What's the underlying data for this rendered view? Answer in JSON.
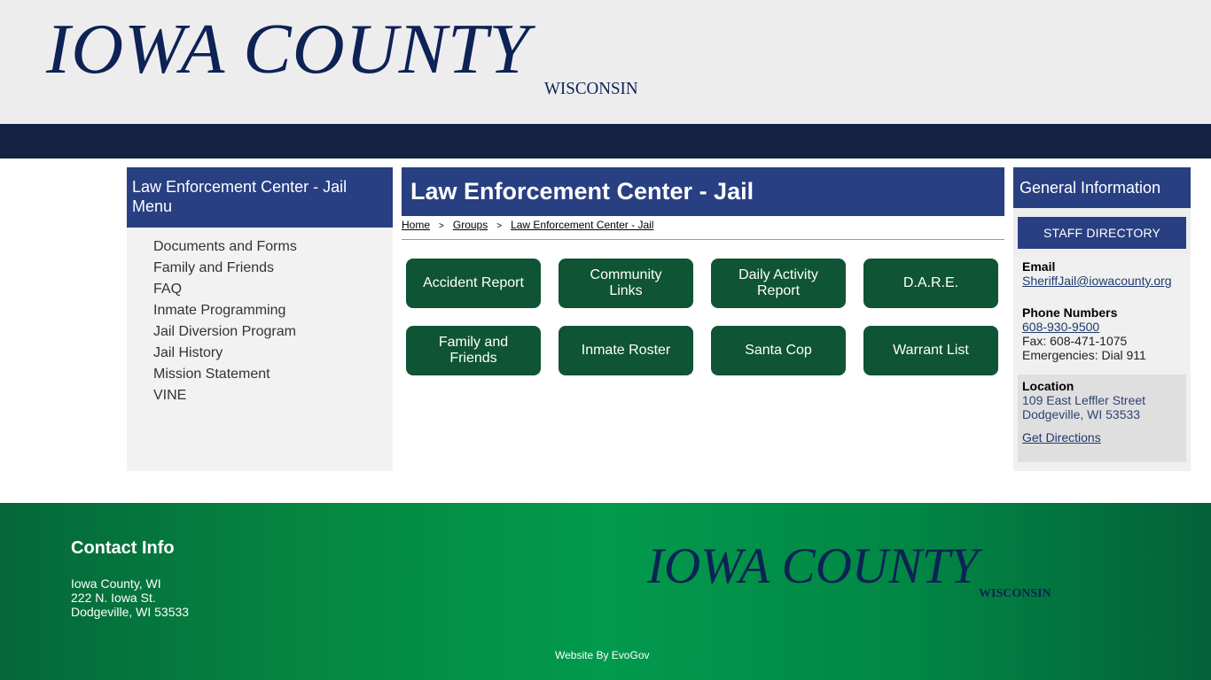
{
  "header": {
    "logo_main": "IOWA COUNTY",
    "logo_sub": "WISCONSIN"
  },
  "left_menu": {
    "title": "Law Enforcement Center - Jail Menu",
    "items": [
      {
        "label": "Documents and Forms"
      },
      {
        "label": "Family and Friends"
      },
      {
        "label": "FAQ"
      },
      {
        "label": "Inmate Programming"
      },
      {
        "label": "Jail Diversion Program"
      },
      {
        "label": "Jail History"
      },
      {
        "label": "Mission Statement"
      },
      {
        "label": "VINE"
      }
    ]
  },
  "main": {
    "title": "Law Enforcement Center - Jail",
    "breadcrumb": [
      {
        "label": "Home"
      },
      {
        "label": "Groups"
      },
      {
        "label": "Law Enforcement Center - Jail"
      }
    ],
    "breadcrumb_separator": ">",
    "tiles": [
      {
        "label": "Accident Report"
      },
      {
        "label": "Community Links"
      },
      {
        "label": "Daily Activity Report"
      },
      {
        "label": "D.A.R.E."
      },
      {
        "label": "Family and Friends"
      },
      {
        "label": "Inmate Roster"
      },
      {
        "label": "Santa Cop"
      },
      {
        "label": "Warrant List"
      }
    ]
  },
  "general_info": {
    "title": "General Information",
    "staff_directory_label": "STAFF DIRECTORY",
    "email_label": "Email",
    "email": "SheriffJail@iowacounty.org",
    "phone_label": "Phone Numbers",
    "phone": "608-930-9500",
    "fax": "Fax: 608-471-1075",
    "emergencies": "Emergencies: Dial 911",
    "location_label": "Location",
    "address_line1": "109 East Leffler Street",
    "address_line2": "Dodgeville, WI 53533",
    "directions_label": "Get Directions"
  },
  "footer": {
    "contact_title": "Contact Info",
    "address_line1": "Iowa County, WI",
    "address_line2": "222 N. Iowa St.",
    "address_line3": "Dodgeville, WI 53533",
    "logo_main": "IOWA COUNTY",
    "logo_sub": "WISCONSIN",
    "credit": "Website By EvoGov"
  },
  "colors": {
    "header_bg": "#ededee",
    "nav_bar": "#132243",
    "panel_blue": "#283f82",
    "tile_green": "#0f5434",
    "logo_navy": "#0d2255",
    "footer_green": "#029a4d"
  }
}
